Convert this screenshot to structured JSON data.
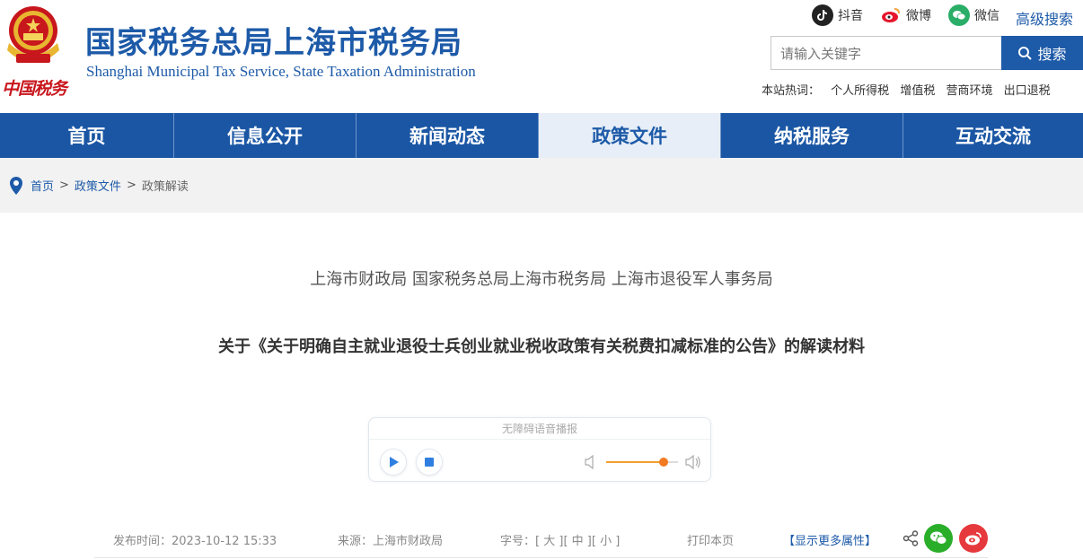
{
  "header": {
    "title_cn": "国家税务总局上海市税务局",
    "title_en": "Shanghai Municipal Tax Service, State Taxation Administration",
    "logo_text": "中国税务",
    "social": [
      {
        "label": "抖音",
        "icon": "douyin-icon",
        "color": "#222222"
      },
      {
        "label": "微博",
        "icon": "weibo-icon",
        "color": "#e6162d"
      },
      {
        "label": "微信",
        "icon": "wechat-icon",
        "color": "#2aae67"
      }
    ],
    "advanced_search": "高级搜索",
    "search": {
      "placeholder": "请输入关键字",
      "button": "搜索"
    },
    "hot_label": "本站热词：",
    "hot_words": [
      "个人所得税",
      "增值税",
      "营商环境",
      "出口退税"
    ]
  },
  "nav": {
    "items": [
      {
        "label": "首页"
      },
      {
        "label": "信息公开"
      },
      {
        "label": "新闻动态"
      },
      {
        "label": "政策文件",
        "active": true
      },
      {
        "label": "纳税服务"
      },
      {
        "label": "互动交流"
      }
    ]
  },
  "breadcrumb": {
    "items": [
      "首页",
      "政策文件",
      "政策解读"
    ],
    "separator": ">"
  },
  "article": {
    "issuer": "上海市财政局 国家税务总局上海市税务局 上海市退役军人事务局",
    "title": "关于《关于明确自主就业退役士兵创业就业税收政策有关税费扣减标准的公告》的解读材料"
  },
  "player": {
    "caption": "无障碍语音播报",
    "volume": 0.8
  },
  "meta": {
    "publish_label": "发布时间：",
    "publish_time": "2023-10-12 15:33",
    "source_label": "来源：",
    "source": "上海市财政局",
    "font_label": "字号：",
    "font_large": "[ 大 ]",
    "font_medium": "[ 中 ]",
    "font_small": "[ 小 ]",
    "print": "打印本页",
    "more": "【显示更多属性】"
  },
  "colors": {
    "brand_blue": "#1d5aa8",
    "nav_blue": "#1a56a4",
    "red": "#c8161d"
  }
}
